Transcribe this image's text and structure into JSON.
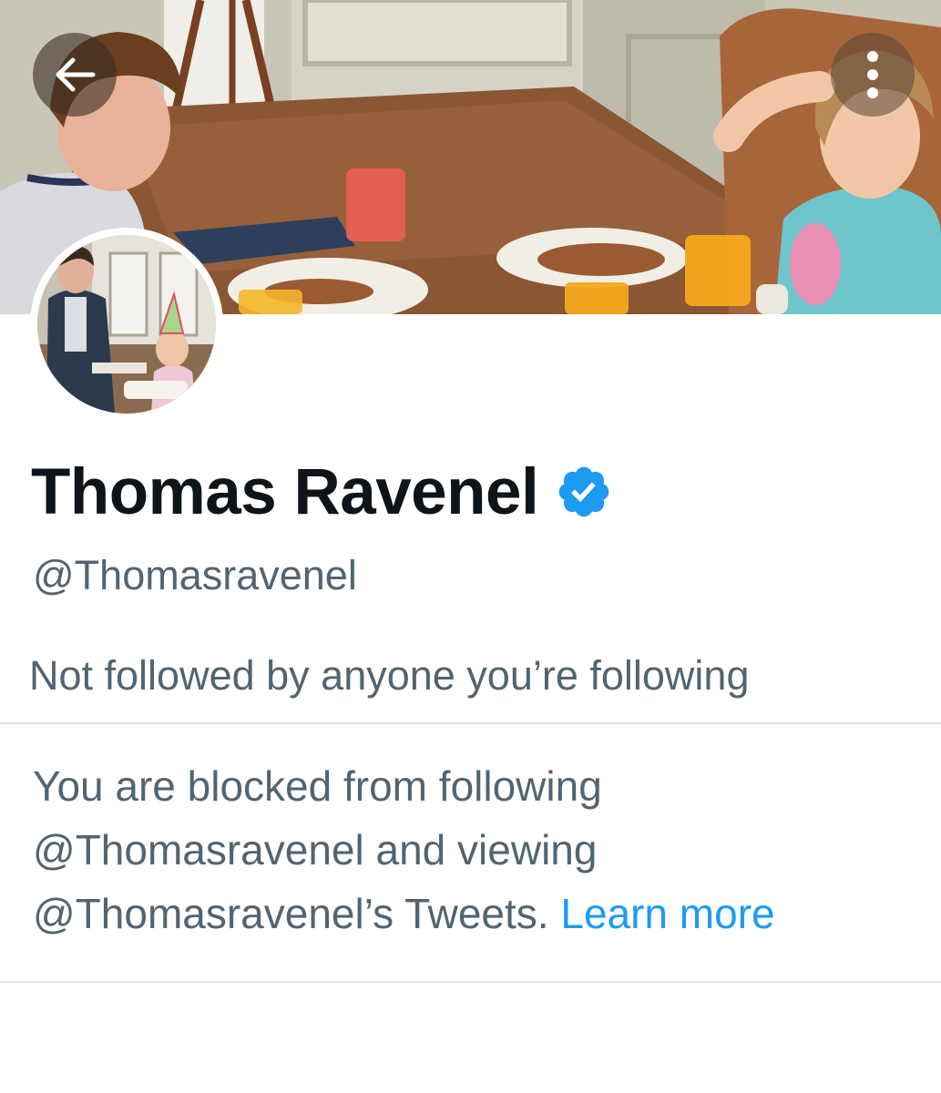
{
  "navigation": {
    "back_icon": "arrow-left-icon",
    "more_icon": "vertical-dots-icon"
  },
  "profile": {
    "display_name": "Thomas Ravenel",
    "verified_icon": "verified-badge-icon",
    "handle": "@Thomasravenel",
    "followed_by_text": "Not followed by anyone you’re following"
  },
  "blocked_notice": {
    "line1": "You are blocked from following",
    "line2": "@Thomasravenel and viewing",
    "line3": "@Thomasravenel’s Tweets.",
    "learn_more": "Learn more"
  },
  "colors": {
    "name": "#0f1419",
    "secondary_text": "#536471",
    "link": "#1d9bf0",
    "verified": "#1d9bf0",
    "divider": "#dde3e7"
  }
}
